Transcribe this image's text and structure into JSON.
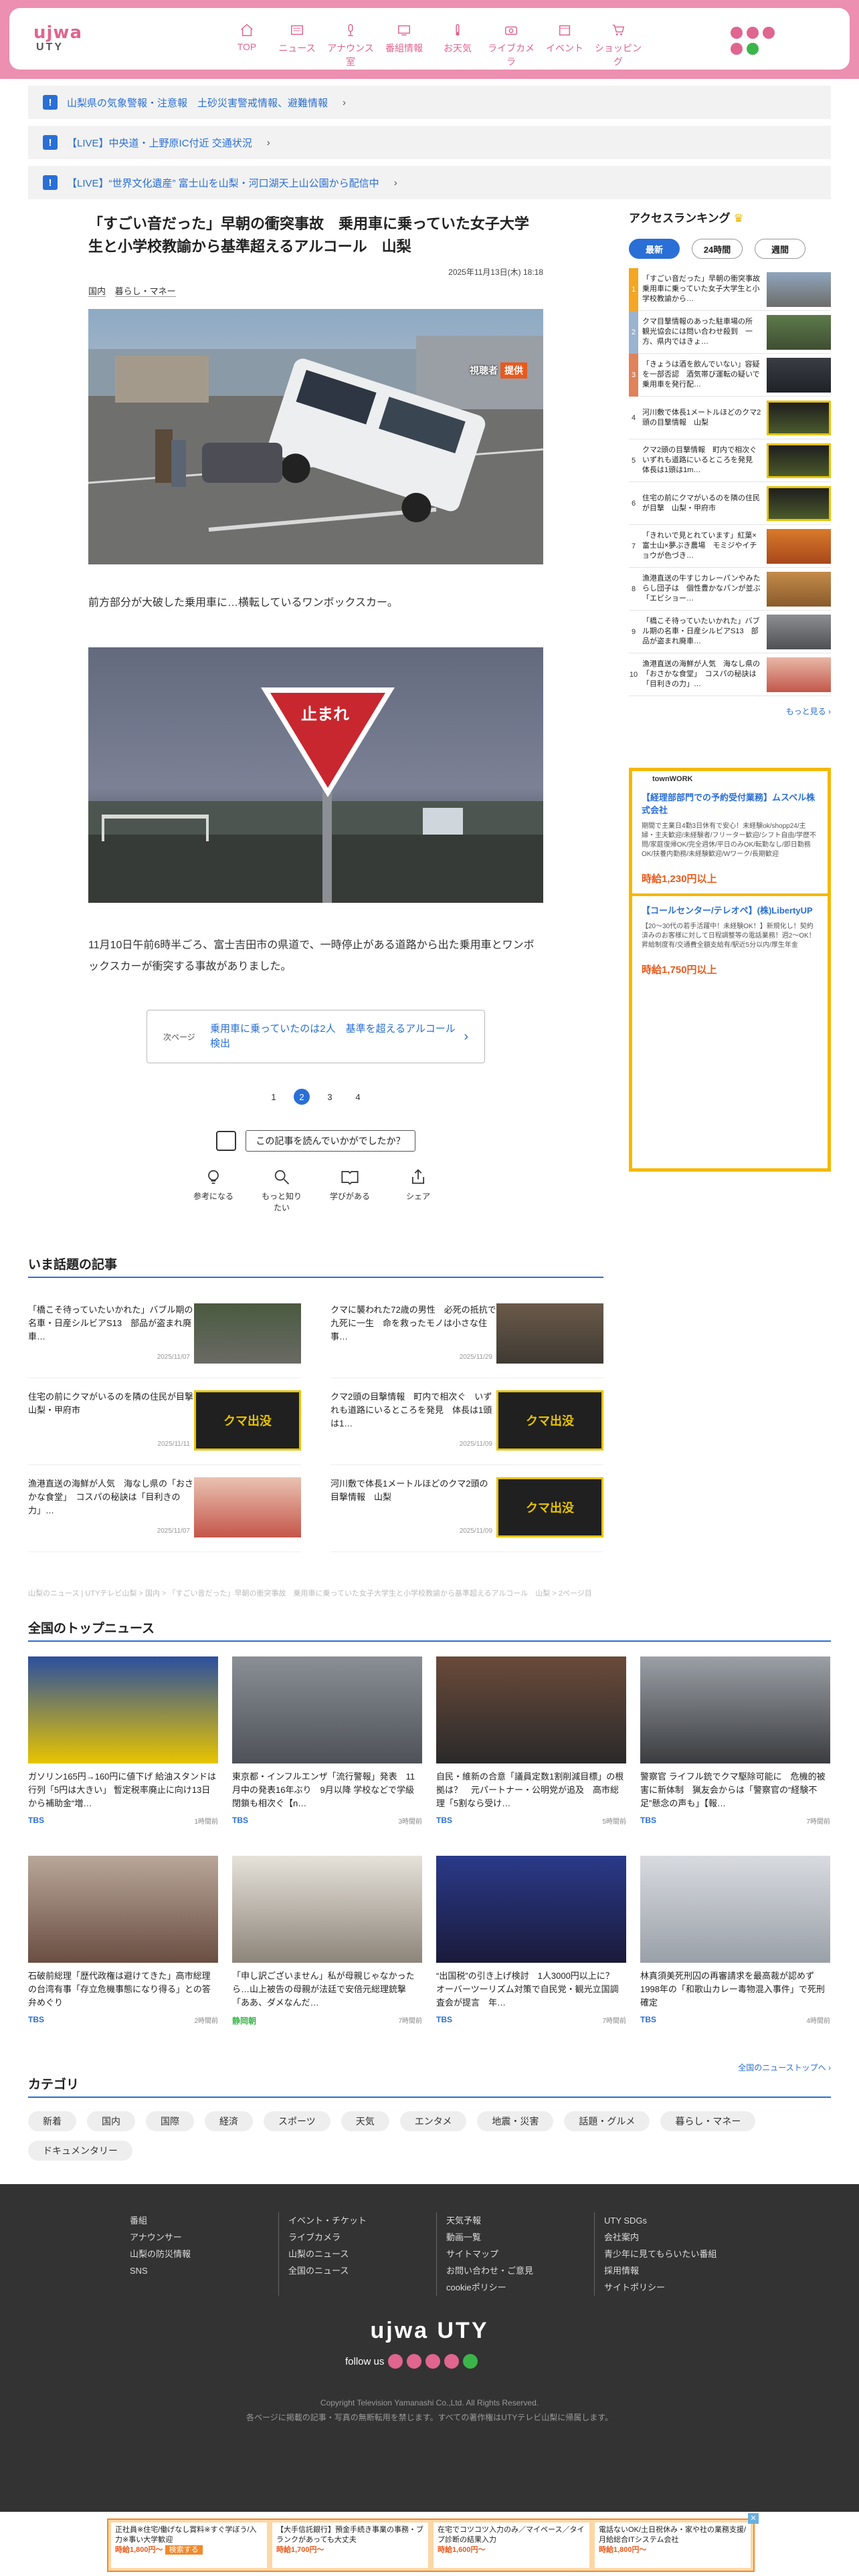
{
  "header": {
    "logo_main": "UTY",
    "logo_kana": "ujwa",
    "nav": [
      {
        "label": "TOP",
        "icon": "home-icon"
      },
      {
        "label": "ニュース",
        "icon": "news-icon"
      },
      {
        "label": "アナウンス室",
        "icon": "microphone-icon"
      },
      {
        "label": "番組情報",
        "icon": "tv-icon"
      },
      {
        "label": "お天気",
        "icon": "thermometer-icon"
      },
      {
        "label": "ライブカメラ",
        "icon": "camera-icon"
      },
      {
        "label": "イベント",
        "icon": "calendar-icon"
      },
      {
        "label": "ショッピング",
        "icon": "cart-icon"
      }
    ]
  },
  "alerts": [
    "山梨県の気象警報・注意報　土砂災害警戒情報、避難情報",
    "【LIVE】中央道・上野原IC付近 交通状況",
    "【LIVE】“世界文化遺産” 富士山を山梨・河口湖天上山公園から配信中"
  ],
  "article": {
    "title": "「すごい音だった」早朝の衝突事故　乗用車に乗っていた女子大学生と小学校教諭から基準超えるアルコール　山梨",
    "date": "2025年11月13日(木) 18:18",
    "tags": [
      "国内",
      "暮らし・マネー"
    ],
    "photo1_badge_a": "視聴者",
    "photo1_badge_b": "提供",
    "sign_text": "止まれ",
    "caption": "前方部分が大破した乗用車に…横転しているワンボックスカー。",
    "body": "11月10日午前6時半ごろ、富士吉田市の県道で、一時停止がある道路から出た乗用車とワンボックスカーが衝突する事故がありました。",
    "next_label": "次ページ",
    "next_title": "乗用車に乗っていたのは2人　基準を超えるアルコール検出",
    "pages": [
      "1",
      "2",
      "3",
      "4"
    ],
    "current_page": "2",
    "question": "この記事を読んでいかがでしたか？",
    "reactions": [
      "参考になる",
      "もっと知りたい",
      "学びがある",
      "シェア"
    ]
  },
  "ranking": {
    "title": "アクセスランキング",
    "tabs": [
      "最新",
      "24時間",
      "週間"
    ],
    "active_tab": "最新",
    "items": [
      {
        "rank": "1",
        "text": "「すごい音だった」早朝の衝突事故　乗用車に乗っていた女子大学生と小学校教諭から…"
      },
      {
        "rank": "2",
        "text": "クマ目撃情報のあった駐車場の所　観光協会には問い合わせ殺到　一方、県内ではきょ…"
      },
      {
        "rank": "3",
        "text": "「きょうは酒を飲んでいない」容疑を一部否認　酒気帯び運転の疑いで乗用車を発行配…"
      },
      {
        "rank": "4",
        "text": "河川敷で体長1メートルほどのクマ2頭の目撃情報　山梨"
      },
      {
        "rank": "5",
        "text": "クマ2頭の目撃情報　町内で相次ぐ　いずれも道路にいるところを発見　体長は1頭は1m…"
      },
      {
        "rank": "6",
        "text": "住宅の前にクマがいるのを隣の住民が目撃　山梨・甲府市"
      },
      {
        "rank": "7",
        "text": "「きれいで見とれています」紅葉×富士山×夢ぶき農場　モミジやイチョウが色づき…"
      },
      {
        "rank": "8",
        "text": "漁港直送の牛すじカレーパンやみたらし団子は　個性豊かなパンが並ぶ「エビショー…"
      },
      {
        "rank": "9",
        "text": "「橋こそ待っていたいかれた」バブル期の名車・日産シルビアS13　部品が盗まれ廃車…"
      },
      {
        "rank": "10",
        "text": "漁港直送の海鮮が人気　海なし県の「おさかな食堂」　コスパの秘訣は「目利きの力」…"
      }
    ],
    "more": "もっと見る"
  },
  "ad": {
    "label": "townWORK",
    "job1_title": "【経理部部門での予約受付業務】ムスベル株式会社",
    "job1_desc": "期間で主業日4勤3日休有で安心！未経験ok/shopp24/主婦・主夫歓迎/未経験者/フリーター歓迎/シフト自由/学歴不問/家庭復帰OK/完全週休/平日のみOK/転勤なし/即日勤務OK/扶養内勤務/未経験歓迎/Wワーク/長期歓迎",
    "job1_pay": "時給1,230円以上",
    "job2_title": "【コールセンター/テレオペ】(株)LibertyUP",
    "job2_desc": "【20～30代の若手活躍中！未経験OK！】新規化し！契約済みのお客様に対して日程調整等の電話業務！週2～OK！昇給制度有/交通費全額支給有/駅近5分以内/厚生年金",
    "job2_pay": "時給1,750円以上"
  },
  "topics": {
    "heading": "いま話題の記事",
    "items": [
      {
        "text": "「橋こそ待っていたいかれた」バブル期の名車・日産シルビアS13　部品が盗まれ廃車…",
        "date": "2025/11/07"
      },
      {
        "text": "クマに襲われた72歳の男性　必死の抵抗で九死に一生　命を救ったモノは小さな住事…",
        "date": "2025/11/29"
      },
      {
        "text": "住宅の前にクマがいるのを隣の住民が目撃　山梨・甲府市",
        "date": "2025/11/11"
      },
      {
        "text": "クマ2頭の目撃情報　町内で相次ぐ　いずれも道路にいるところを発見　体長は1頭は1…",
        "date": "2025/11/09"
      },
      {
        "text": "漁港直送の海鮮が人気　海なし県の「おさかな食堂」　コスパの秘訣は「目利きの力」…",
        "date": "2025/11/07"
      },
      {
        "text": "河川敷で体長1メートルほどのクマ2頭の目撃情報　山梨",
        "date": "2025/11/09"
      }
    ],
    "kuma_label": "クマ出没"
  },
  "breadcrumb": "山梨のニュース | UTYテレビ山梨 > 国内 > 「すごい音だった」早朝の衝突事故　乗用車に乗っていた女子大学生と小学校教諭から基準超えるアルコール　山梨 > 2ページ目",
  "national": {
    "heading": "全国のトップニュース",
    "items": [
      {
        "text": "ガソリン165円→160円に値下げ 給油スタンドは行列「5円は大きい」 暫定税率廃止に向け13日から補助金“増…",
        "src": "TBS",
        "time": "1時間前"
      },
      {
        "text": "東京都・インフルエンザ「流行警報」発表　11月中の発表16年ぶり　9月以降 学校などで学級閉鎖も相次ぐ【n…",
        "src": "TBS",
        "time": "3時間前"
      },
      {
        "text": "自民・維新の合意「議員定数1割削減目標」の根拠は？　元パートナー・公明党が追及　高市総理「5割なら受け…",
        "src": "TBS",
        "time": "5時間前"
      },
      {
        "text": "警察官 ライフル銃でクマ駆除可能に　危機的被害に新体制　猟友会からは「警察官の“経験不足”懸念の声も」【報…",
        "src": "TBS",
        "time": "7時間前"
      },
      {
        "text": "石破前総理「歴代政権は避けてきた」高市総理の台湾有事「存立危機事態になり得る」との答弁めぐり",
        "src": "TBS",
        "time": "2時間前"
      },
      {
        "text": "「申し訳ございません」私が母親じゃなかったら…山上被告の母親が法廷で安倍元総理銃撃「ああ、ダメなんだ…",
        "src": "静岡朝",
        "time": "7時間前"
      },
      {
        "text": "“出国税”の引き上げ検討　1人3000円以上に？　オーバーツーリズム対策で自民党・観光立国調査会が提言　年…",
        "src": "TBS",
        "time": "7時間前"
      },
      {
        "text": "林真須美死刑囚の再審請求を最高裁が認めず　1998年の「和歌山カレー毒物混入事件」で死刑確定",
        "src": "TBS",
        "time": "4時間前"
      }
    ],
    "more": "全国のニューストップへ"
  },
  "categories": {
    "heading": "カテゴリ",
    "items": [
      "新着",
      "国内",
      "国際",
      "経済",
      "スポーツ",
      "天気",
      "エンタメ",
      "地震・災害",
      "話題・グルメ",
      "暮らし・マネー",
      "ドキュメンタリー"
    ]
  },
  "footer": {
    "cols": [
      [
        "番組",
        "アナウンサー",
        "山梨の防災情報",
        "SNS"
      ],
      [
        "イベント・チケット",
        "ライブカメラ",
        "山梨のニュース",
        "全国のニュース"
      ],
      [
        "天気予報",
        "動画一覧",
        "サイトマップ",
        "お問い合わせ・ご意見",
        "cookieポリシー"
      ],
      [
        "UTY SDGs",
        "会社案内",
        "青少年に見てもらいたい番組",
        "採用情報",
        "サイトポリシー"
      ]
    ],
    "logo": "ujwa UTY",
    "follow": "follow us",
    "copyright": "Copyright Television Yamanashi Co.,Ltd. All Rights Reserved.",
    "notice": "各ページに掲載の記事・写真の無断転用を禁じます。すべての著作権はUTYテレビ山梨に帰属します。"
  },
  "bottom_ad": [
    {
      "text": "正社員※住宅/働げなし賞料※すぐ学ぼう/入力※事い大学歓迎",
      "pay": "時給1,800円～",
      "btn": "検索する"
    },
    {
      "text": "【大手信託銀行】預金手続き事業の事務・ブランクがあっても大丈夫",
      "pay": "時給1,700円～"
    },
    {
      "text": "在宅でコツコツ入力のみ／マイペース／タイプ診断の結果入力",
      "pay": "時給1,600円～"
    },
    {
      "text": "電話ないOK/土日祝休み・家や社の業務支援/月給総合ITシステム会社",
      "pay": "時給1,800円～"
    }
  ]
}
